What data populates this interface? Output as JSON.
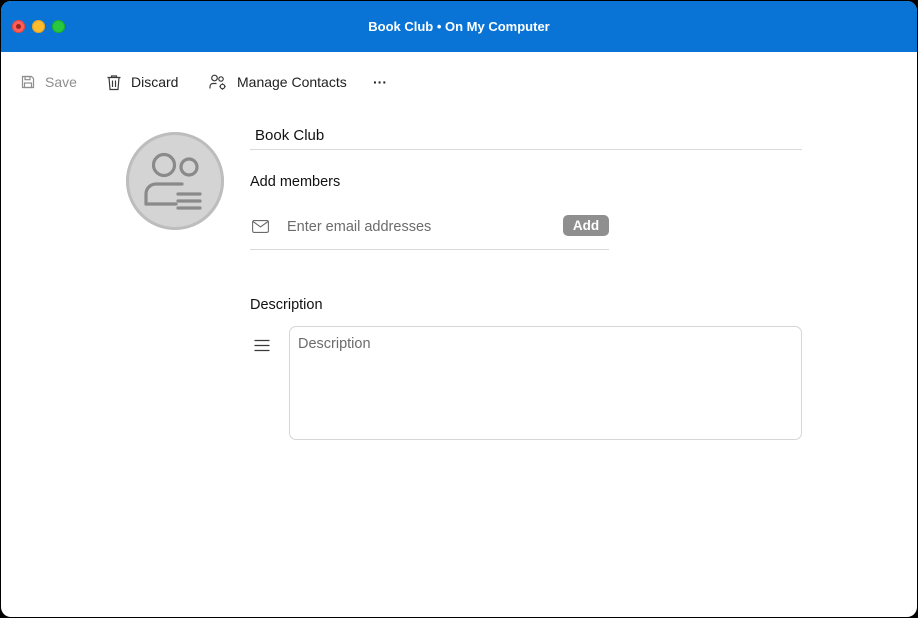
{
  "window": {
    "title": "Book Club • On My Computer",
    "controls": [
      "close",
      "minimize",
      "maximize"
    ]
  },
  "toolbar": {
    "save": {
      "label": "Save",
      "icon": "save-icon",
      "enabled": false
    },
    "discard": {
      "label": "Discard",
      "icon": "trash-icon"
    },
    "manage_contacts": {
      "label": "Manage Contacts",
      "icon": "people-settings-icon"
    },
    "more": {
      "label": "···",
      "icon": "more-icon"
    }
  },
  "group": {
    "avatar_icon": "group-avatar-icon",
    "name": "Book Club"
  },
  "members": {
    "heading": "Add members",
    "email_placeholder": "Enter email addresses",
    "email_value": "",
    "add_label": "Add"
  },
  "description": {
    "heading": "Description",
    "placeholder": "Description",
    "value": ""
  },
  "colors": {
    "titlebar": "#0a74d6",
    "add_button": "#8f8f8f",
    "avatar_bg": "#d4d4d4"
  }
}
